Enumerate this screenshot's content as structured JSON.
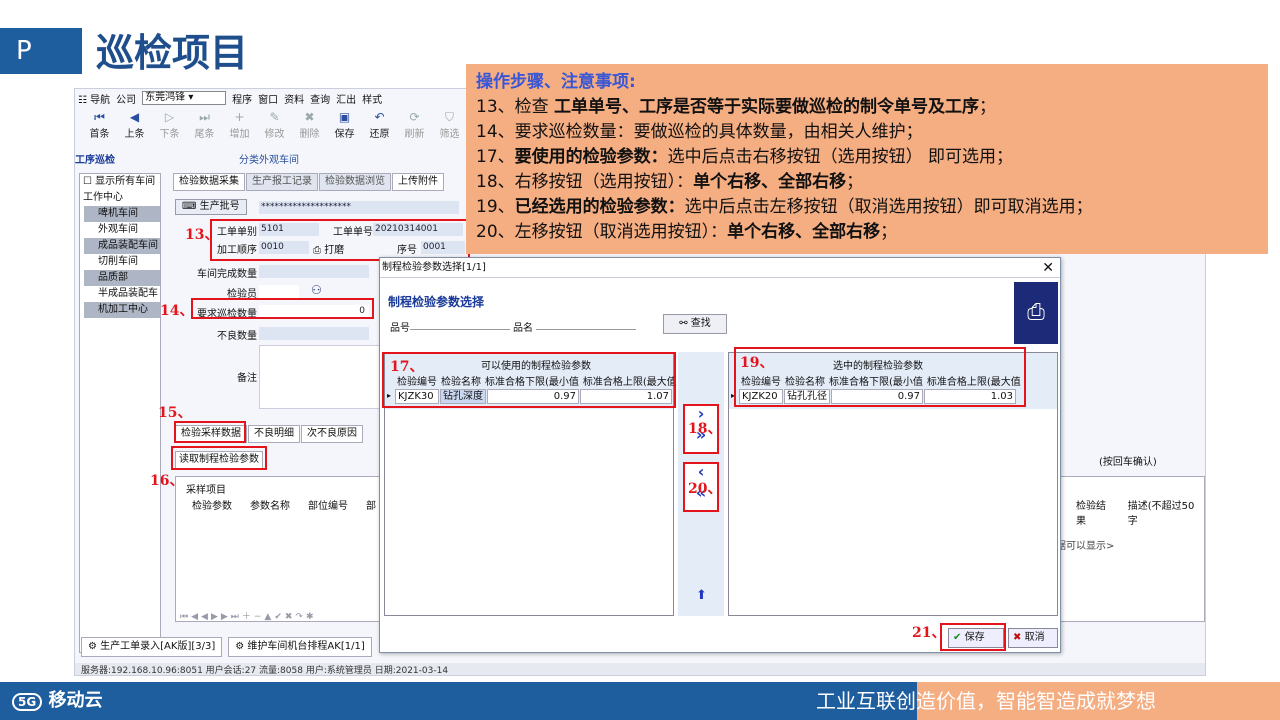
{
  "slide": {
    "p_label": "P",
    "title": "巡检项目",
    "slogan": "工业互联创造价值，智能智造成就梦想",
    "logo": "移动云",
    "logo_badge": "5G"
  },
  "menubar": {
    "nav": "导航",
    "company_label": "公司",
    "company_value": "东莞鸿锋",
    "items": [
      "程序",
      "窗口",
      "资料",
      "查询",
      "汇出",
      "样式"
    ]
  },
  "toolbar": {
    "buttons": [
      {
        "label": "首条",
        "icon": "⏮"
      },
      {
        "label": "上条",
        "icon": "◀"
      },
      {
        "label": "下条",
        "icon": "▷"
      },
      {
        "label": "尾条",
        "icon": "⏭"
      },
      {
        "label": "增加",
        "icon": "+"
      },
      {
        "label": "修改",
        "icon": "✎"
      },
      {
        "label": "删除",
        "icon": "✖"
      },
      {
        "label": "保存",
        "icon": "▣"
      },
      {
        "label": "还原",
        "icon": "↶"
      },
      {
        "label": "刷新",
        "icon": "⟳"
      },
      {
        "label": "筛选",
        "icon": "⛉"
      }
    ]
  },
  "section": {
    "left": "工序巡检",
    "right": "分类外观车间"
  },
  "left_panel": {
    "checkbox_label": "显示所有车间",
    "items": [
      "工作中心",
      "啤机车间",
      "外观车间",
      "成品装配车间",
      "切削车间",
      "品质部",
      "半成品装配车",
      "机加工中心"
    ]
  },
  "tabs_top": [
    "检验数据采集",
    "生产报工记录",
    "检验数据浏览",
    "上传附件"
  ],
  "form": {
    "batch_button": "生产批号",
    "batch_value": "********************",
    "work_order_type_label": "工单单别",
    "work_order_type": "5101",
    "work_order_no_label": "工单单号",
    "work_order_no": "20210314001",
    "process_seq_label": "加工顺序",
    "process_seq": "0010",
    "print_label": "打磨",
    "seq_no_label": "序号",
    "seq_no": "0001",
    "workshop_qty_label": "车间完成数量",
    "inspector_label": "检验员",
    "required_qty_label": "要求巡检数量",
    "required_qty": "0",
    "defect_qty_label": "不良数量",
    "remark_label": "备注"
  },
  "tabs_bottom": [
    "检验采样数据",
    "不良明细",
    "次不良原因"
  ],
  "read_params_button": "读取制程检验参数",
  "sample_grid": {
    "title": "采样项目",
    "columns": [
      "检验参数",
      "参数名称",
      "部位编号",
      "部"
    ],
    "right_columns": [
      "检验结果",
      "描述(不超过50字"
    ],
    "hint_right": "(按回车确认)",
    "hint_display": "据可以显示>"
  },
  "bottom_tabs": [
    "生产工单录入[AK版][3/3]",
    "维护车间机台排程AK[1/1]"
  ],
  "status_bar": "服务器:192.168.10.96:8051  用户会话:27  流量:8058   用户:系统管理员                       日期:2021-03-14",
  "instructions": {
    "heading": "操作步骤、注意事项:",
    "lines": [
      {
        "pre": "13、检查 ",
        "bold": "工单单号、工序是否等于实际要做巡检的制令单号及工序",
        "post": "；"
      },
      {
        "pre": "14、要求巡检数量：要做巡检的具体数量，由相关人维护；",
        "bold": "",
        "post": ""
      },
      {
        "pre": "17、",
        "bold": "要使用的检验参数：",
        "post": "选中后点击右移按钮（选用按钮） 即可选用；"
      },
      {
        "pre": "18、右移按钮（选用按钮）：",
        "bold": "单个右移、全部右移",
        "post": "；"
      },
      {
        "pre": "19、",
        "bold": "已经选用的检验参数：",
        "post": "选中后点击左移按钮（取消选用按钮）即可取消选用；"
      },
      {
        "pre": "20、左移按钮（取消选用按钮）：",
        "bold": "单个右移、全部右移",
        "post": "；"
      }
    ]
  },
  "dialog": {
    "title": "制程检验参数选择[1/1]",
    "heading": "制程检验参数选择",
    "part_no_label": "品号",
    "part_name_label": "品名",
    "search_button": "查找",
    "available": {
      "title": "可以使用的制程检验参数",
      "columns": [
        "检验编号",
        "检验名称",
        "标准合格下限(最小值",
        "标准合格上限(最大值"
      ],
      "rows": [
        [
          "KJZK30",
          "钻孔深度",
          "0.97",
          "1.07"
        ]
      ]
    },
    "selected": {
      "title": "选中的制程检验参数",
      "columns": [
        "检验编号",
        "检验名称",
        "标准合格下限(最小值",
        "标准合格上限(最大值"
      ],
      "rows": [
        [
          "KJZK20",
          "钻孔孔径",
          "0.97",
          "1.03"
        ]
      ]
    },
    "move_right_single": "›",
    "move_right_all": "»",
    "move_left_single": "‹",
    "move_left_all": "«",
    "ok_button": "保存",
    "cancel_button": "取消"
  },
  "markers": [
    "13、",
    "14、",
    "15、",
    "16、",
    "17、",
    "18、",
    "19、",
    "20、",
    "21、"
  ],
  "colors": {
    "brand_blue": "#1f5e9e",
    "annotation_red": "#e3141c",
    "note_orange": "#f5ad82",
    "heading_blue": "#3856d6"
  }
}
